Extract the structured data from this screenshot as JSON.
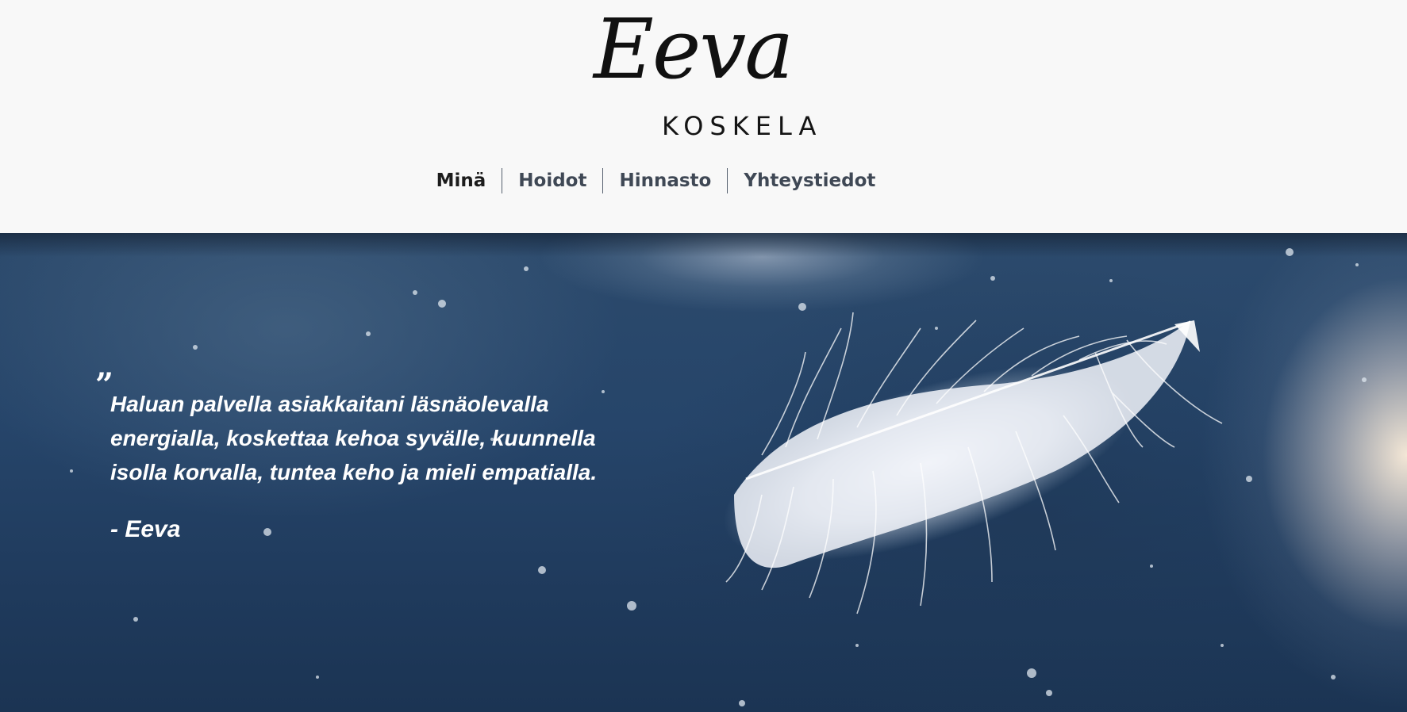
{
  "logo": {
    "script": "Eeva",
    "subtitle": "KOSKELA"
  },
  "nav": {
    "items": [
      {
        "label": "Minä",
        "active": true
      },
      {
        "label": "Hoidot",
        "active": false
      },
      {
        "label": "Hinnasto",
        "active": false
      },
      {
        "label": "Yhteystiedot",
        "active": false
      }
    ]
  },
  "hero": {
    "quote_mark": "”",
    "quote": "Haluan palvella asiakkaitani läsnäolevalla energialla, koskettaa kehoa syvälle, kuunnella isolla korvalla, tuntea keho ja mieli empatialla.",
    "author": "- Eeva",
    "image": "feather-icon"
  },
  "colors": {
    "header_bg": "#f8f8f8",
    "nav_text": "#3f4855",
    "nav_active": "#1c1c1c",
    "hero_bg": "#26456a",
    "quote_text": "#ffffff"
  }
}
